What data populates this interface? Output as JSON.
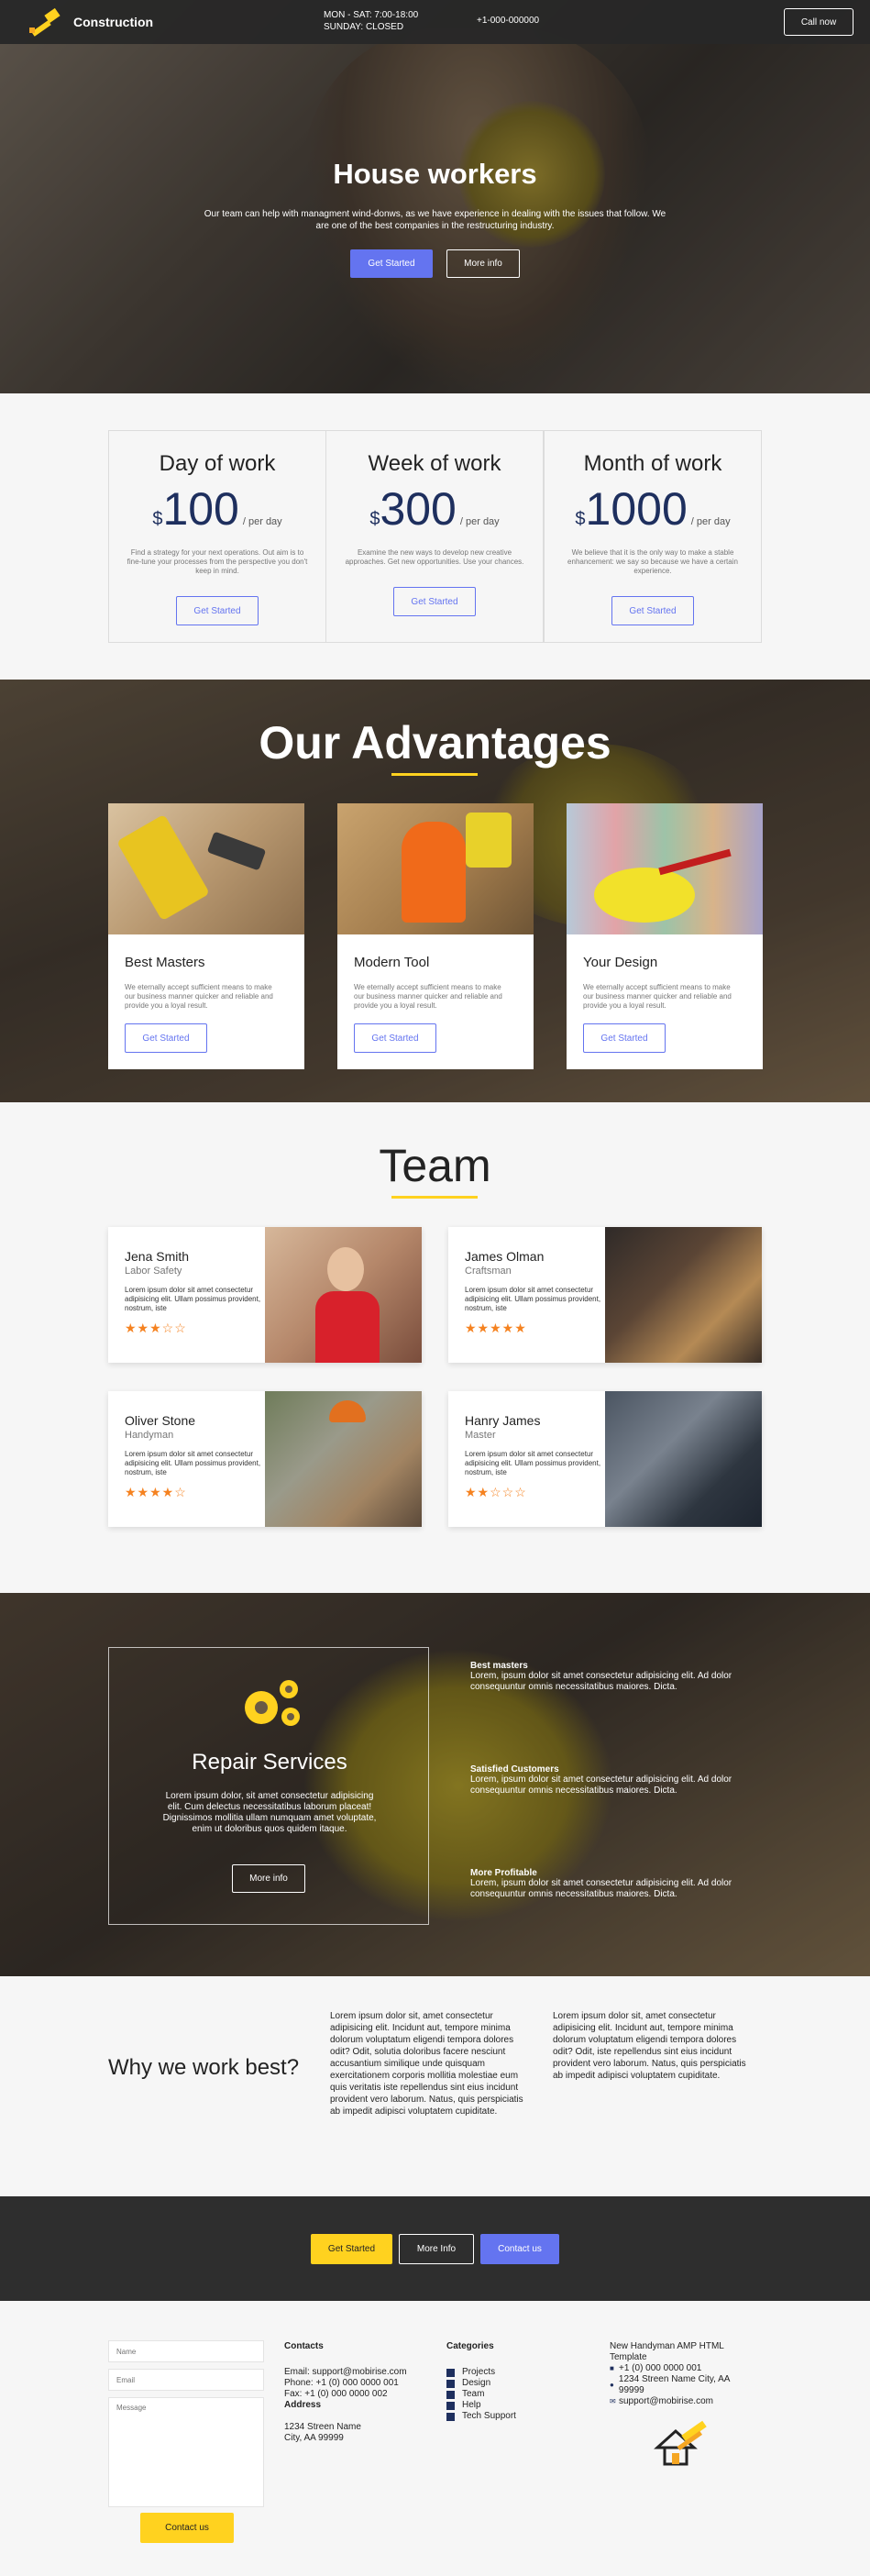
{
  "nav": {
    "brand": "Construction",
    "hours_line1": "MON - SAT: 7:00-18:00",
    "hours_line2": "SUNDAY: CLOSED",
    "phone": "+1-000-000000",
    "cta": "Call now",
    "logo_icon": "hammer-logo-icon"
  },
  "hero": {
    "title": "House workers",
    "text": "Our team can help with managment wind-donws, as we have experience in dealing with the issues that follow. We are one of the best companies in the restructuring industry.",
    "primary": "Get Started",
    "secondary": "More info"
  },
  "pricing": [
    {
      "title": "Day of work",
      "currency": "$",
      "amount": "100",
      "per": "/ per day",
      "text": "Find a strategy for your next operations. Out aim is to fine-tune your processes from the perspective you don't keep in mind.",
      "button": "Get Started"
    },
    {
      "title": "Week of work",
      "currency": "$",
      "amount": "300",
      "per": "/ per day",
      "text": "Examine the new ways to develop new creative approaches. Get new opportunities. Use your chances.",
      "button": "Get Started"
    },
    {
      "title": "Month of work",
      "currency": "$",
      "amount": "1000",
      "per": "/ per day",
      "text": "We believe that it is the only way to make a stable enhancement: we say so because we have a certain experience.",
      "button": "Get Started"
    }
  ],
  "advantages": {
    "title": "Our Advantages",
    "cards": [
      {
        "title": "Best Masters",
        "text": "We eternally accept sufficient means to make our business manner quicker and reliable and provide you a loyal result.",
        "button": "Get Started"
      },
      {
        "title": "Modern Tool",
        "text": "We eternally accept sufficient means to make our business manner quicker and reliable and provide you a loyal result.",
        "button": "Get Started"
      },
      {
        "title": "Your Design",
        "text": "We eternally accept sufficient means to make our business manner quicker and reliable and provide you a loyal result.",
        "button": "Get Started"
      }
    ]
  },
  "team": {
    "title": "Team",
    "members": [
      {
        "name": "Jena Smith",
        "role": "Labor Safety",
        "text": "Lorem ipsum dolor sit amet consectetur adipisicing elit. Ullam possimus provident, nostrum, iste",
        "rating": 3,
        "stars": "★★★☆☆"
      },
      {
        "name": "James Olman",
        "role": "Craftsman",
        "text": "Lorem ipsum dolor sit amet consectetur adipisicing elit. Ullam possimus provident, nostrum, iste",
        "rating": 5,
        "stars": "★★★★★"
      },
      {
        "name": "Oliver Stone",
        "role": "Handyman",
        "text": "Lorem ipsum dolor sit amet consectetur adipisicing elit. Ullam possimus provident, nostrum, iste",
        "rating": 4,
        "stars": "★★★★☆"
      },
      {
        "name": "Hanry James",
        "role": "Master",
        "text": "Lorem ipsum dolor sit amet consectetur adipisicing elit. Ullam possimus provident, nostrum, iste",
        "rating": 2,
        "stars": "★★☆☆☆"
      }
    ]
  },
  "repair": {
    "title": "Repair Services",
    "text": "Lorem ipsum dolor, sit amet consectetur adipisicing elit. Cum delectus necessitatibus laborum placeat! Dignissimos mollitia ullam numquam amet voluptate, enim ut doloribus quos quidem itaque.",
    "button": "More info",
    "features": [
      {
        "title": "Best masters",
        "text": "Lorem, ipsum dolor sit amet consectetur adipisicing elit. Ad dolor consequuntur omnis necessitatibus maiores. Dicta."
      },
      {
        "title": "Satisfied Customers",
        "text": "Lorem, ipsum dolor sit amet consectetur adipisicing elit. Ad dolor consequuntur omnis necessitatibus maiores. Dicta."
      },
      {
        "title": "More Profitable",
        "text": "Lorem, ipsum dolor sit amet consectetur adipisicing elit. Ad dolor consequuntur omnis necessitatibus maiores. Dicta."
      }
    ]
  },
  "why": {
    "title": "Why we work best?",
    "col1": "Lorem ipsum dolor sit, amet consectetur adipisicing elit. Incidunt aut, tempore minima dolorum voluptatum eligendi tempora dolores odit? Odit, solutia doloribus facere nesciunt accusantium similique unde quisquam exercitationem corporis mollitia molestiae eum quis veritatis iste repellendus sint eius incidunt provident vero laborum. Natus, quis perspiciatis ab impedit adipisci voluptatem cupiditate.",
    "col2": "Lorem ipsum dolor sit, amet consectetur adipisicing elit. Incidunt aut, tempore minima dolorum voluptatum eligendi tempora dolores odit? Odit, iste repellendus sint eius incidunt provident vero laborum. Natus, quis perspiciatis ab impedit adipisci voluptatem cupiditate."
  },
  "cta": {
    "get_started": "Get Started",
    "more_info": "More Info",
    "contact": "Contact us"
  },
  "footer": {
    "name_placeholder": "Name",
    "email_placeholder": "Email",
    "message_placeholder": "Message",
    "send": "Contact us",
    "contacts_title": "Contacts",
    "email": "Email: support@mobirise.com",
    "phone": "Phone: +1 (0) 000 0000 001",
    "fax": "Fax: +1 (0) 000 0000 002",
    "address_title": "Address",
    "address1": "1234 Streen Name",
    "address2": "City, AA 99999",
    "categories_title": "Categories",
    "categories": [
      "Projects",
      "Design",
      "Team",
      "Help",
      "Tech Support"
    ],
    "about_title": "New Handyman AMP HTML Template",
    "about_phone": "+1 (0) 000 0000 001",
    "about_address": "1234 Streen Name City, AA 99999",
    "about_email": "support@mobirise.com"
  },
  "colors": {
    "accent_blue": "#6474f0",
    "accent_yellow": "#ffd21f",
    "navy": "#1e2f5e",
    "star_orange": "#f58220",
    "dark": "#2e2e2e"
  }
}
